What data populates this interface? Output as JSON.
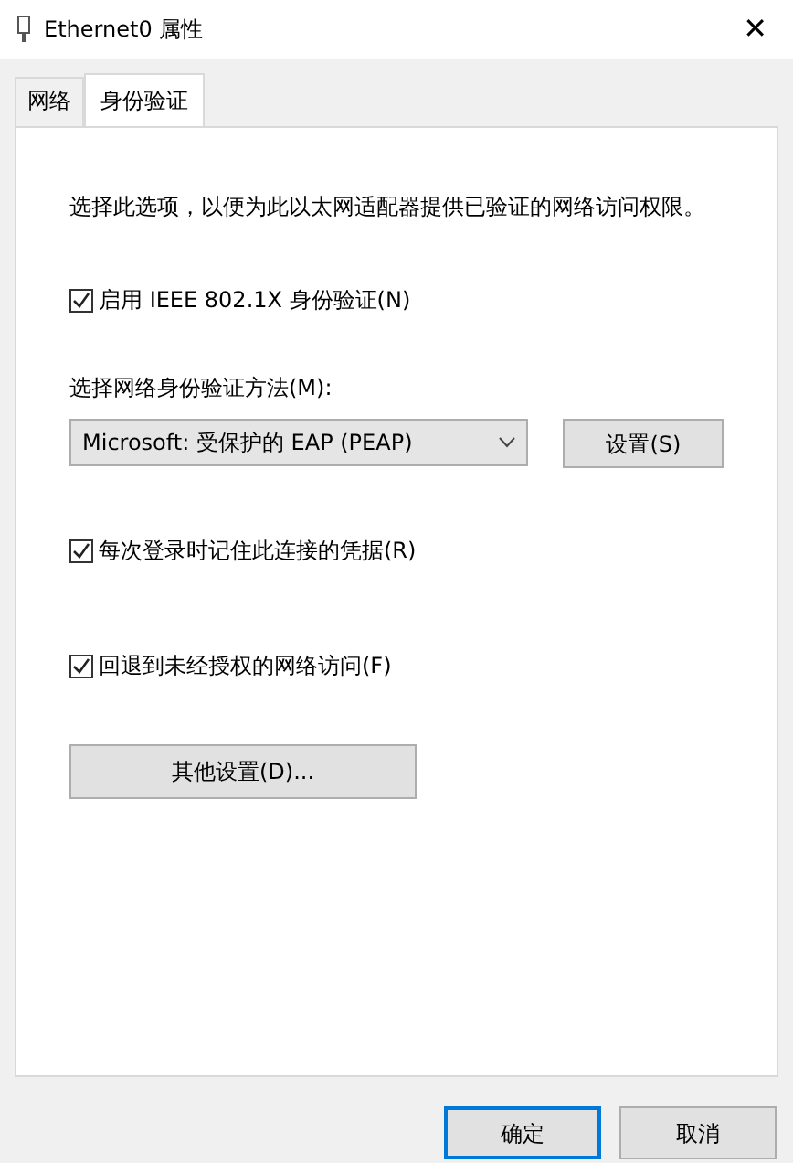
{
  "window": {
    "title": "Ethernet0 属性",
    "close": "✕"
  },
  "tabs": [
    {
      "label": "网络",
      "selected": false
    },
    {
      "label": "身份验证",
      "selected": true
    }
  ],
  "description": "选择此选项，以便为此以太网适配器提供已验证的网络访问权限。",
  "enable_8021x": {
    "label": "启用 IEEE 802.1X 身份验证(N)",
    "checked": true
  },
  "method": {
    "label": "选择网络身份验证方法(M):",
    "value": "Microsoft: 受保护的 EAP (PEAP)",
    "settings_button": "设置(S)"
  },
  "options": [
    {
      "label": "每次登录时记住此连接的凭据(R)",
      "checked": true
    },
    {
      "label": "回退到未经授权的网络访问(F)",
      "checked": true
    }
  ],
  "additional_settings_button": "其他设置(D)...",
  "buttons": [
    {
      "label": "确定",
      "default": true
    },
    {
      "label": "取消",
      "default": false
    }
  ]
}
